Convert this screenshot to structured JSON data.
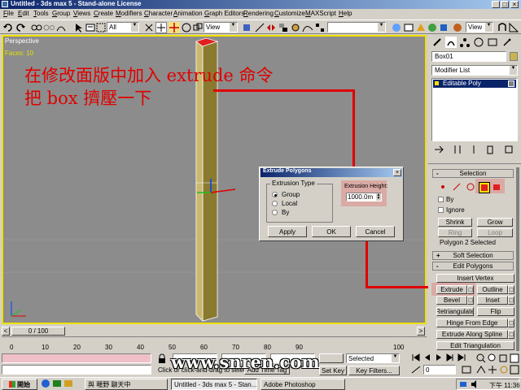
{
  "title_bar": {
    "text": "Untitled - 3ds max 5 - Stand-alone License"
  },
  "menu": [
    "File",
    "Edit",
    "Tools",
    "Group",
    "Views",
    "Create",
    "Modifiers",
    "Character",
    "Animation",
    "Graph Editors",
    "Rendering",
    "Customize",
    "MAXScript",
    "Help"
  ],
  "toolbar": {
    "selection_filter": "All",
    "ref_coord": "View",
    "ref_coord_right": "View"
  },
  "viewport": {
    "label": "Perspective",
    "frame_label": "Faces: 10",
    "annotation_line1": "在修改面版中加入 extrude 命令",
    "annotation_line2": "把 box 擠壓一下"
  },
  "dialog": {
    "title": "Extrude Polygons",
    "group_label": "Extrusion Type",
    "options": [
      "Group",
      "Local",
      "By"
    ],
    "height_label": "Extrusion Height:",
    "height_value": "1000.0m",
    "apply": "Apply",
    "ok": "OK",
    "cancel": "Cancel"
  },
  "command_panel": {
    "object_name": "Box01",
    "modifier_list": "Modifier List",
    "stack_item": "Editable Poly",
    "selection_header": "Selection",
    "by_label": "By",
    "ignore_label": "Ignore",
    "shrink": "Shrink",
    "grow": "Grow",
    "ring": "Ring",
    "loop": "Loop",
    "selected_info": "Polygon 2 Selected",
    "soft_selection": "Soft Selection",
    "edit_polygons": "Edit Polygons",
    "insert_vertex": "Insert Vertex",
    "extrude": "Extrude",
    "outline": "Outline",
    "bevel": "Bevel",
    "inset": "Inset",
    "retriangulate": "Retriangulate",
    "flip": "Flip",
    "hinge": "Hinge From Edge",
    "extrude_spline": "Extrude Along Spline",
    "edit_triangulation": "Edit Triangulation"
  },
  "timeline": {
    "slider": "0 / 100",
    "ticks": [
      "0",
      "10",
      "20",
      "30",
      "40",
      "50",
      "60",
      "70",
      "80",
      "90",
      "100"
    ]
  },
  "status": {
    "prompt": "Click or click-and-drag to select",
    "add_time_tag": "Add Time Tag",
    "selected_dropdown": "Selected",
    "set_key": "Set Key",
    "key_filters": "Key Filters...",
    "frame_field": "0",
    "watermark": "www.snren.com"
  },
  "taskbar": {
    "start": "開始",
    "items": [
      "與 暱野 聊天中",
      "Untitled - 3ds max 5 - Stan...",
      "Adobe Photoshop"
    ],
    "clock": "下午 11:36"
  },
  "colors": {
    "viewport": "#8c8c8c",
    "annotation": "#e00000",
    "titlebar": "#0a246a",
    "box": "#b6a55a"
  }
}
